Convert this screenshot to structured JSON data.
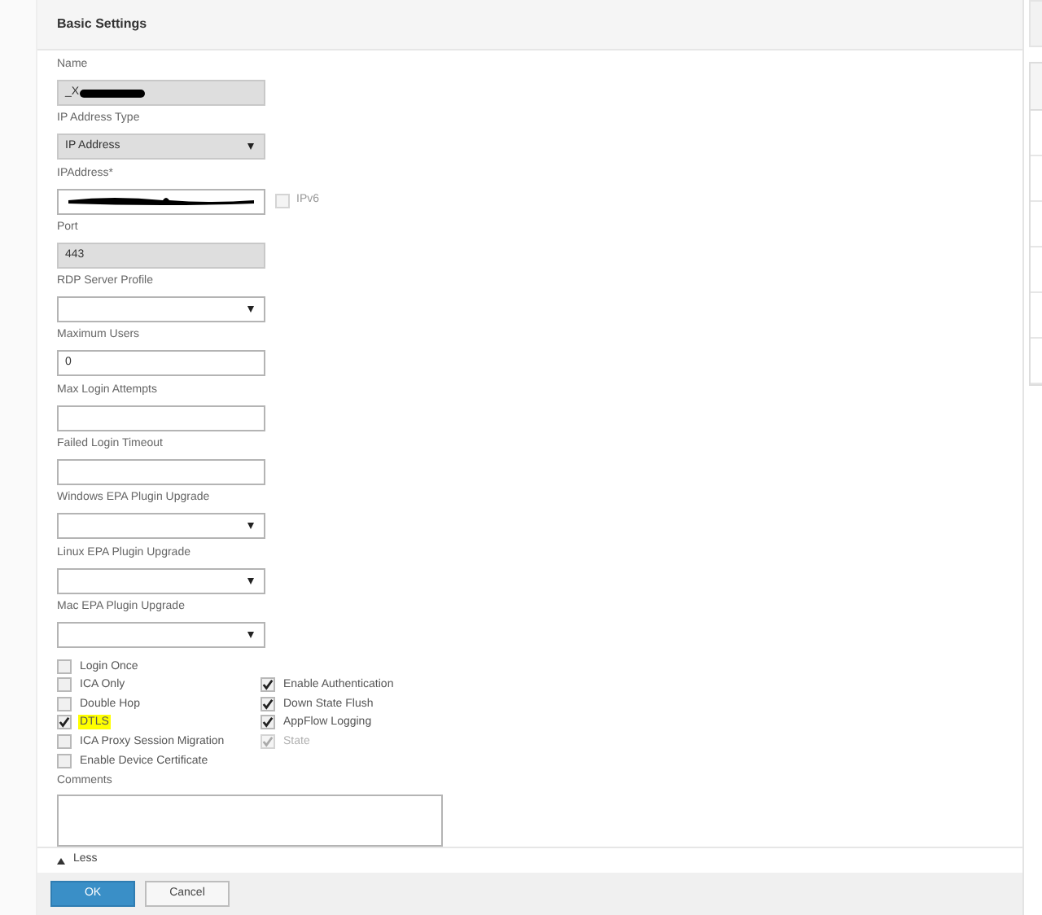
{
  "panel": {
    "title": "Basic Settings"
  },
  "fields": [
    {
      "label": "Name",
      "kind": "text",
      "value": "_X",
      "redacted": true,
      "disabled": true
    },
    {
      "label": "IP Address Type",
      "kind": "select",
      "value": "IP Address",
      "disabled": true
    },
    {
      "label": "IPAddress*",
      "kind": "text",
      "redacted": true,
      "disabled": false,
      "option": {
        "label": "IPv6",
        "checked": false
      }
    },
    {
      "label": "Port",
      "kind": "text",
      "value": "443",
      "disabled": true
    },
    {
      "label": "RDP Server Profile",
      "kind": "select",
      "disabled": false
    },
    {
      "label": "Maximum Users",
      "kind": "text",
      "value": "0",
      "disabled": false
    },
    {
      "label": "Max Login Attempts",
      "kind": "text",
      "disabled": false
    },
    {
      "label": "Failed Login Timeout",
      "kind": "text",
      "disabled": false
    },
    {
      "label": "Windows EPA Plugin Upgrade",
      "kind": "select",
      "disabled": false
    },
    {
      "label": "Linux EPA Plugin Upgrade",
      "kind": "select",
      "disabled": false
    },
    {
      "label": "Mac EPA Plugin Upgrade",
      "kind": "select",
      "disabled": false
    }
  ],
  "checkboxes_left": [
    {
      "label": "Login Once",
      "checked": false,
      "disabled": false,
      "highlighted": false
    },
    {
      "label": "ICA Only",
      "checked": false,
      "disabled": false,
      "highlighted": false
    },
    {
      "label": "Double Hop",
      "checked": false,
      "disabled": false,
      "highlighted": false
    },
    {
      "label": "DTLS",
      "checked": true,
      "disabled": false,
      "highlighted": true
    },
    {
      "label": "ICA Proxy Session Migration",
      "checked": false,
      "disabled": false,
      "highlighted": false
    },
    {
      "label": "Enable Device Certificate",
      "checked": false,
      "disabled": false,
      "highlighted": false
    }
  ],
  "checkboxes_right": [
    {
      "label": "Enable Authentication",
      "checked": true,
      "disabled": false,
      "highlighted": false
    },
    {
      "label": "Down State Flush",
      "checked": true,
      "disabled": false,
      "highlighted": false
    },
    {
      "label": "AppFlow Logging",
      "checked": true,
      "disabled": false,
      "highlighted": false
    },
    {
      "label": "State",
      "checked": true,
      "disabled": true,
      "highlighted": false
    }
  ],
  "comments": {
    "label": "Comments"
  },
  "toggle": {
    "label": "Less",
    "expanded": true
  },
  "buttons": [
    {
      "label": "OK",
      "kind": "primary"
    },
    {
      "label": "Cancel",
      "kind": "secondary"
    }
  ]
}
